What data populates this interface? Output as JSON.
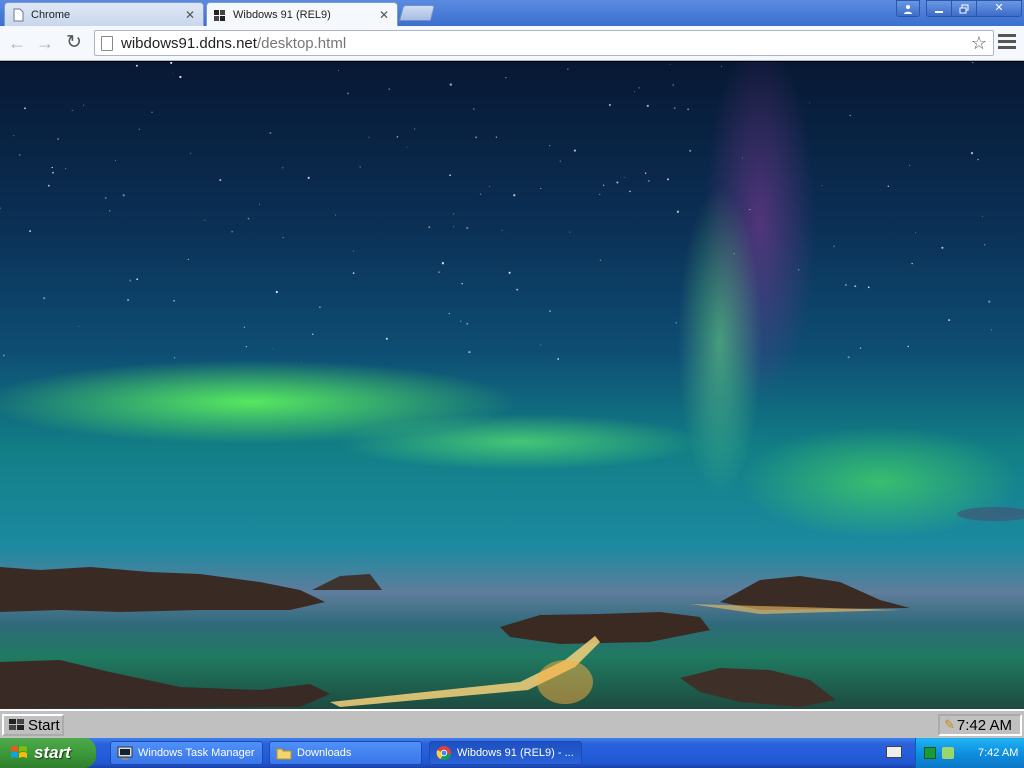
{
  "browser": {
    "tabs": [
      {
        "title": "Chrome",
        "active": false,
        "icon": "page-icon"
      },
      {
        "title": "Wibdows 91 (REL9)",
        "active": true,
        "icon": "wibdows-logo-icon"
      }
    ],
    "url": {
      "host": "wibdows91.ddns.net",
      "path": "/desktop.html"
    }
  },
  "win91_taskbar": {
    "start_label": "Start",
    "clock": "7:42 AM"
  },
  "xp_taskbar": {
    "start_label": "start",
    "tasks": [
      {
        "label": "Windows Task Manager",
        "icon": "task-manager-icon"
      },
      {
        "label": "Downloads",
        "icon": "folder-icon"
      },
      {
        "label": "Wibdows 91 (REL9) - ...",
        "icon": "chrome-icon",
        "active": true
      }
    ],
    "clock": "7:42 AM"
  },
  "colors": {
    "xp_blue": "#245edb",
    "xp_start_green": "#3c9a3a",
    "win91_gray": "#c0c0c0",
    "aurora_green": "#64ff5a"
  }
}
